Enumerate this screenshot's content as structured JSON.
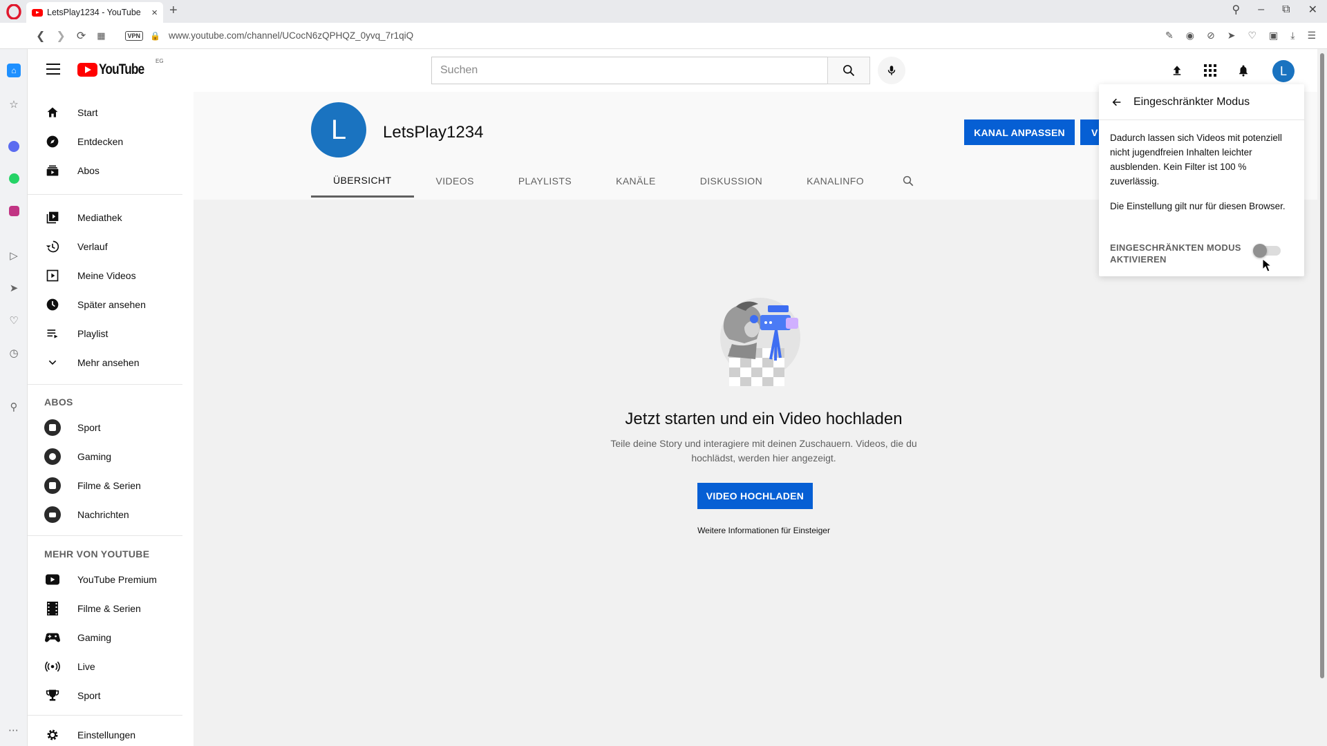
{
  "browser": {
    "tab_title": "LetsPlay1234 - YouTube",
    "url": "www.youtube.com/channel/UCocN6zQPHQZ_0yvq_7r1qiQ",
    "vpn_label": "VPN"
  },
  "masthead": {
    "country_code": "EG",
    "logo_text": "YouTube",
    "search_placeholder": "Suchen",
    "avatar_letter": "L"
  },
  "guide": {
    "main": [
      {
        "label": "Start",
        "icon": "home-icon"
      },
      {
        "label": "Entdecken",
        "icon": "compass-icon"
      },
      {
        "label": "Abos",
        "icon": "subscriptions-icon"
      }
    ],
    "library": [
      {
        "label": "Mediathek",
        "icon": "library-icon"
      },
      {
        "label": "Verlauf",
        "icon": "history-icon"
      },
      {
        "label": "Meine Videos",
        "icon": "my-videos-icon"
      },
      {
        "label": "Später ansehen",
        "icon": "watch-later-icon"
      },
      {
        "label": "Playlist",
        "icon": "playlist-icon"
      },
      {
        "label": "Mehr ansehen",
        "icon": "chevron-down-icon"
      }
    ],
    "subs_heading": "ABOS",
    "subs": [
      {
        "label": "Sport"
      },
      {
        "label": "Gaming"
      },
      {
        "label": "Filme & Serien"
      },
      {
        "label": "Nachrichten"
      }
    ],
    "more_heading": "MEHR VON YOUTUBE",
    "more": [
      {
        "label": "YouTube Premium",
        "icon": "youtube-premium-icon"
      },
      {
        "label": "Filme & Serien",
        "icon": "film-icon"
      },
      {
        "label": "Gaming",
        "icon": "gamepad-icon"
      },
      {
        "label": "Live",
        "icon": "live-icon"
      },
      {
        "label": "Sport",
        "icon": "trophy-icon"
      }
    ],
    "settings_label": "Einstellungen"
  },
  "channel": {
    "avatar_letter": "L",
    "name": "LetsPlay1234",
    "customize_button": "KANAL ANPASSEN",
    "manage_button_visible": "V",
    "tabs": [
      "ÜBERSICHT",
      "VIDEOS",
      "PLAYLISTS",
      "KANÄLE",
      "DISKUSSION",
      "KANALINFO"
    ],
    "active_tab": "ÜBERSICHT"
  },
  "empty_state": {
    "title": "Jetzt starten und ein Video hochladen",
    "description": "Teile deine Story und interagiere mit deinen Zuschauern. Videos, die du hochlädst, werden hier angezeigt.",
    "upload_button": "VIDEO HOCHLADEN",
    "learn_more": "Weitere Informationen für Einsteiger"
  },
  "restricted_mode": {
    "title": "Eingeschränkter Modus",
    "description": "Dadurch lassen sich Videos mit potenziell nicht jugendfreien Inhalten leichter ausblenden. Kein Filter ist 100 % zuverlässig.",
    "note": "Die Einstellung gilt nur für diesen Browser.",
    "toggle_label": "EINGESCHRÄNKTEN MODUS AKTIVIEREN",
    "toggle_on": false
  },
  "colors": {
    "accent_blue": "#065fd4",
    "avatar_blue": "#1a73c0",
    "youtube_red": "#ff0000"
  }
}
